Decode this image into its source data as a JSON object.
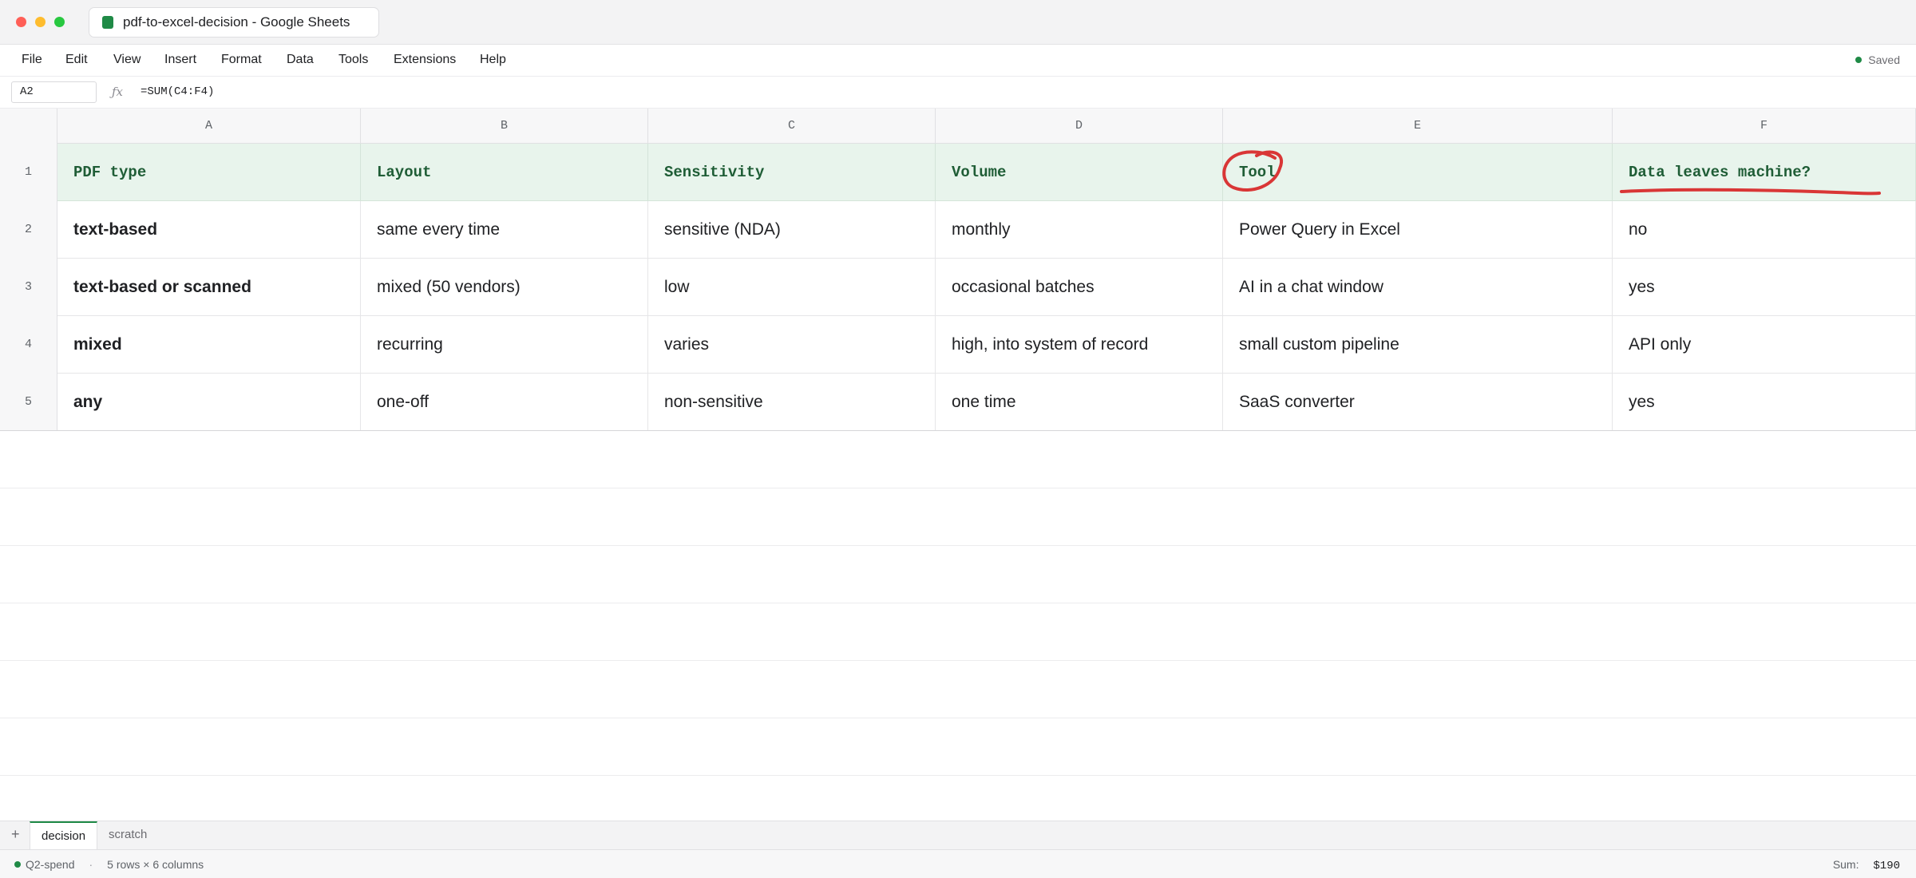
{
  "window": {
    "tab_title": "pdf-to-excel-decision - Google Sheets"
  },
  "menu": {
    "items": [
      "File",
      "Edit",
      "View",
      "Insert",
      "Format",
      "Data",
      "Tools",
      "Extensions",
      "Help"
    ],
    "status": "Saved"
  },
  "formula_bar": {
    "cell_ref": "A2",
    "fx_symbol": "ƒx",
    "formula": "=SUM(C4:F4)"
  },
  "grid": {
    "columns": [
      "A",
      "B",
      "C",
      "D",
      "E",
      "F"
    ],
    "row_numbers": [
      "1",
      "2",
      "3",
      "4",
      "5"
    ],
    "header": [
      "PDF type",
      "Layout",
      "Sensitivity",
      "Volume",
      "Tool",
      "Data leaves machine?"
    ],
    "rows": [
      [
        "text-based",
        "same every time",
        "sensitive (NDA)",
        "monthly",
        "Power Query in Excel",
        "no"
      ],
      [
        "text-based or scanned",
        "mixed (50 vendors)",
        "low",
        "occasional batches",
        "AI in a chat window",
        "yes"
      ],
      [
        "mixed",
        "recurring",
        "varies",
        "high, into system of record",
        "small custom pipeline",
        "API only"
      ],
      [
        "any",
        "one-off",
        "non-sensitive",
        "one time",
        "SaaS converter",
        "yes"
      ]
    ]
  },
  "annotations": {
    "color": "#d93636",
    "circle_target": "E1",
    "underline_target": "F1"
  },
  "sheets": {
    "add_label": "+",
    "tabs": [
      "decision",
      "scratch"
    ],
    "active": "decision"
  },
  "status_bar": {
    "workbook": "Q2-spend",
    "separator": "·",
    "dimensions": "5 rows × 6 columns",
    "sum_label": "Sum:",
    "sum_value": "$190"
  },
  "colors": {
    "accent": "#1f8a46",
    "header_fill": "#e8f4ec",
    "header_text": "#1f5d36"
  }
}
